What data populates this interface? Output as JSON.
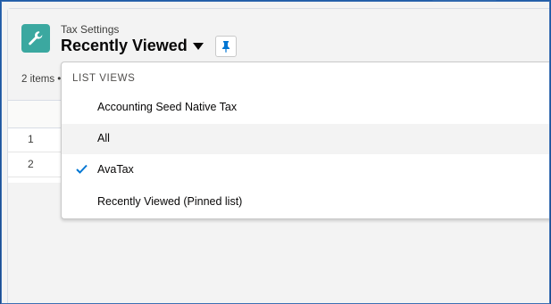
{
  "header": {
    "object_label": "Tax Settings",
    "list_view_title": "Recently Viewed",
    "item_count_text": "2 items •"
  },
  "table": {
    "rows": [
      "1",
      "2"
    ]
  },
  "dropdown": {
    "heading": "LIST VIEWS",
    "items": [
      {
        "label": "Accounting Seed Native Tax",
        "selected": false
      },
      {
        "label": "All",
        "selected": false
      },
      {
        "label": "AvaTax",
        "selected": true
      },
      {
        "label": "Recently Viewed (Pinned list)",
        "selected": false
      }
    ]
  },
  "colors": {
    "accent": "#0176d3",
    "app_icon": "#3ba8a0",
    "background": "#1b4a8c"
  }
}
